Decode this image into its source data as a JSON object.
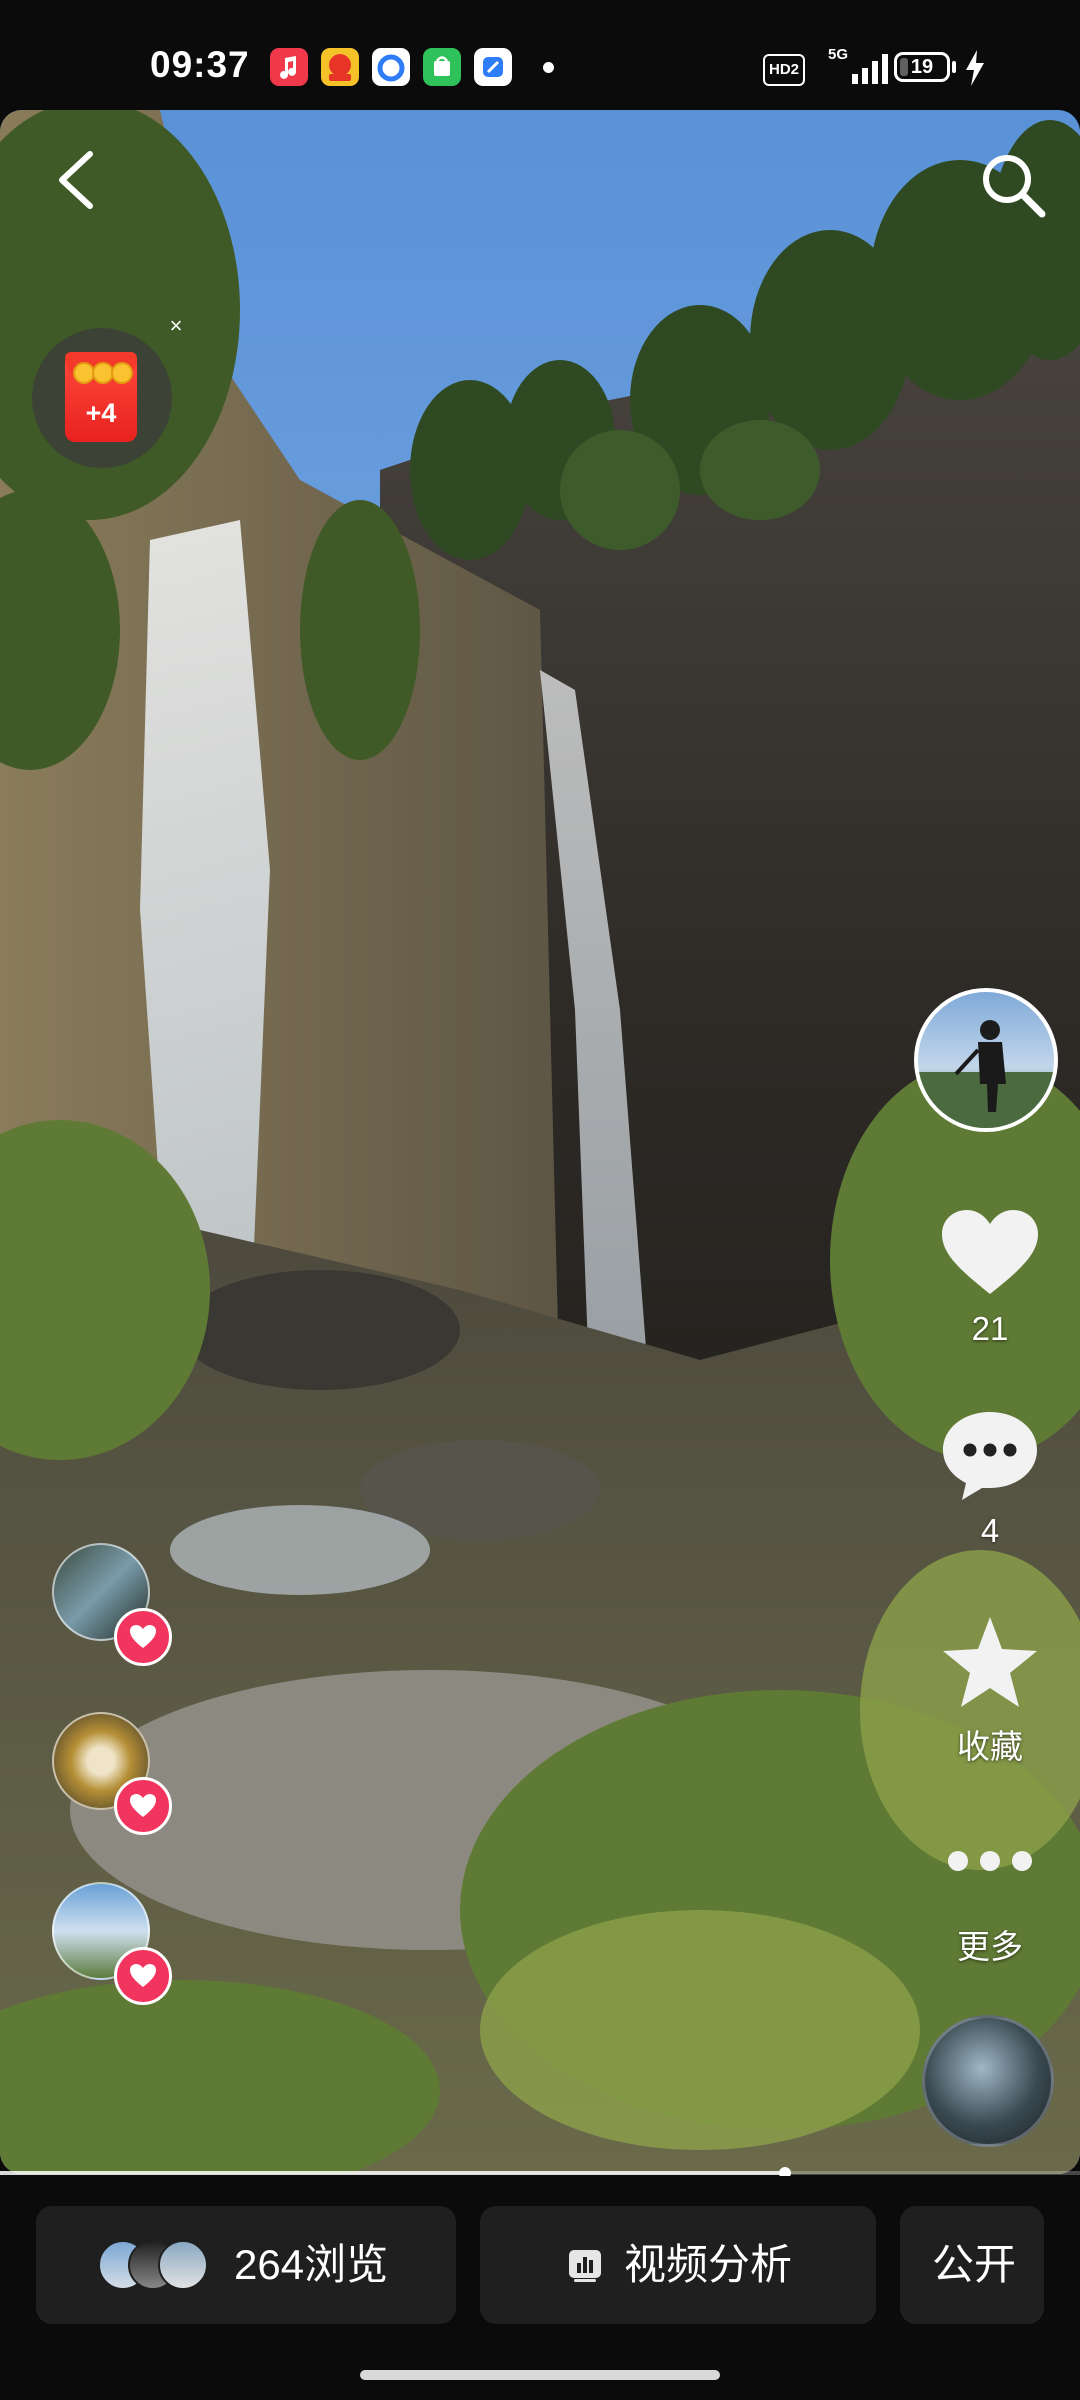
{
  "status_bar": {
    "time": "09:37",
    "hd_label": "HD2",
    "network_label": "5G",
    "battery_level": 19,
    "battery_text": "19",
    "charging": true,
    "notification_icons": [
      "music-app-icon",
      "shopping-app-icon",
      "browser-app-icon",
      "store-app-icon",
      "files-app-icon"
    ]
  },
  "reward": {
    "count": "+4",
    "close_label": "×"
  },
  "right_rail": {
    "like_count": "21",
    "comment_count": "4",
    "favorite_label": "收藏",
    "more_label": "更多"
  },
  "video": {
    "progress_fraction": 0.727
  },
  "bottom_bar": {
    "views_label": "264浏览",
    "analysis_label": "视频分析",
    "public_label": "公开"
  },
  "colors": {
    "accent_pink": "#f1355f",
    "bar_background": "#1f1f1f"
  }
}
